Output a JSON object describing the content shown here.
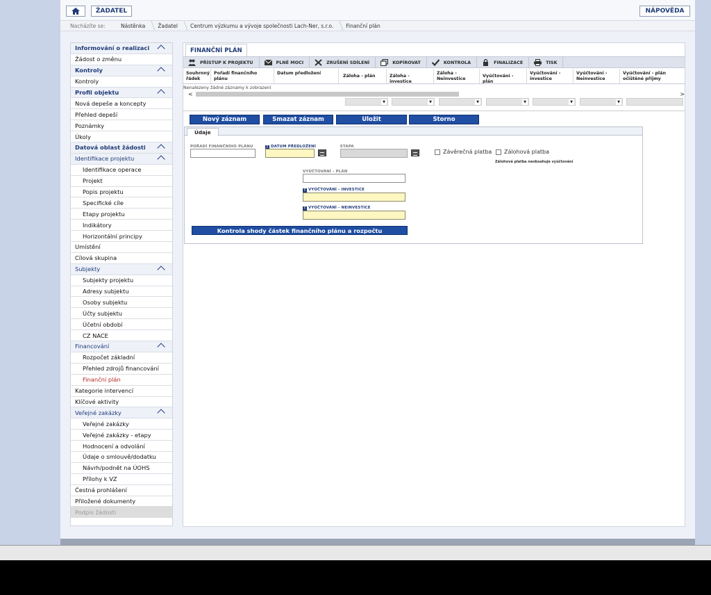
{
  "topbar": {
    "zadatel_label": "ŽADATEL",
    "napoveda_label": "NÁPOVĚDA"
  },
  "breadcrumb": {
    "label": "Nacházíte se:",
    "items": [
      "Nástěnka",
      "Žadatel",
      "Centrum výzkumu a vývoje společnosti Lach-Ner, s.r.o.",
      "Finanční plán"
    ]
  },
  "sidebar": {
    "items": [
      {
        "label": "Informování o realizaci",
        "kind": "header",
        "collapsible": true
      },
      {
        "label": "Žádost o změnu",
        "kind": "item"
      },
      {
        "label": "Kontroly",
        "kind": "header",
        "collapsible": true
      },
      {
        "label": "Kontroly",
        "kind": "item"
      },
      {
        "label": "Profil objektu",
        "kind": "header",
        "collapsible": true
      },
      {
        "label": "Nová depeše a koncepty",
        "kind": "item"
      },
      {
        "label": "Přehled depeší",
        "kind": "item"
      },
      {
        "label": "Poznámky",
        "kind": "item"
      },
      {
        "label": "Úkoly",
        "kind": "item"
      },
      {
        "label": "Datová oblast žádosti",
        "kind": "header",
        "collapsible": true
      },
      {
        "label": "Identifikace projektu",
        "kind": "sect",
        "collapsible": true
      },
      {
        "label": "Identifikace operace",
        "kind": "sub"
      },
      {
        "label": "Projekt",
        "kind": "sub"
      },
      {
        "label": "Popis projektu",
        "kind": "sub"
      },
      {
        "label": "Specifické cíle",
        "kind": "sub"
      },
      {
        "label": "Etapy projektu",
        "kind": "sub"
      },
      {
        "label": "Indikátory",
        "kind": "sub"
      },
      {
        "label": "Horizontální principy",
        "kind": "sub"
      },
      {
        "label": "Umístění",
        "kind": "item"
      },
      {
        "label": "Cílová skupina",
        "kind": "item"
      },
      {
        "label": "Subjekty",
        "kind": "sect",
        "collapsible": true
      },
      {
        "label": "Subjekty projektu",
        "kind": "sub"
      },
      {
        "label": "Adresy subjektu",
        "kind": "sub"
      },
      {
        "label": "Osoby subjektu",
        "kind": "sub"
      },
      {
        "label": "Účty subjektu",
        "kind": "sub"
      },
      {
        "label": "Účetní období",
        "kind": "sub"
      },
      {
        "label": "CZ NACE",
        "kind": "sub"
      },
      {
        "label": "Financování",
        "kind": "sect",
        "collapsible": true
      },
      {
        "label": "Rozpočet základní",
        "kind": "sub"
      },
      {
        "label": "Přehled zdrojů financování",
        "kind": "sub"
      },
      {
        "label": "Finanční plán",
        "kind": "sub",
        "active": true
      },
      {
        "label": "Kategorie intervencí",
        "kind": "item"
      },
      {
        "label": "Klíčové aktivity",
        "kind": "item"
      },
      {
        "label": "Veřejné zakázky",
        "kind": "sect",
        "collapsible": true
      },
      {
        "label": "Veřejné zakázky",
        "kind": "sub"
      },
      {
        "label": "Veřejné zakázky - etapy",
        "kind": "sub"
      },
      {
        "label": "Hodnocení a odvolání",
        "kind": "sub"
      },
      {
        "label": "Údaje o smlouvě/dodatku",
        "kind": "sub"
      },
      {
        "label": "Návrh/podnět na ÚOHS",
        "kind": "sub"
      },
      {
        "label": "Přílohy k VZ",
        "kind": "sub"
      },
      {
        "label": "Čestná prohlášení",
        "kind": "item"
      },
      {
        "label": "Přiložené dokumenty",
        "kind": "item"
      },
      {
        "label": "Podpis žádosti",
        "kind": "disabled"
      }
    ]
  },
  "main": {
    "tab_title": "FINANČNÍ PLÁN",
    "toolbar": [
      {
        "label": "PŘÍSTUP K PROJEKTU",
        "icon": "people-icon"
      },
      {
        "label": "PLNÉ MOCI",
        "icon": "envelope-icon"
      },
      {
        "label": "ZRUŠENÍ SDÍLENÍ",
        "icon": "close-icon"
      },
      {
        "label": "KOPÍROVAT",
        "icon": "copy-icon"
      },
      {
        "label": "KONTROLA",
        "icon": "check-icon"
      },
      {
        "label": "FINALIZACE",
        "icon": "lock-icon"
      },
      {
        "label": "TISK",
        "icon": "printer-icon"
      }
    ],
    "grid": {
      "columns": [
        "Souhrnný řádek",
        "Pořadí finančního plánu",
        "Datum předložení",
        "Záloha - plán",
        "Záloha - investice",
        "Záloha - Neinvestice",
        "Vyúčtování - plán",
        "Vyúčtování - investice",
        "Vyúčtování - Neinvestice",
        "Vyúčtování - plán očištěné příjmy"
      ],
      "empty_text": "Nenalezeny žádné záznamy k zobrazení",
      "scroll_left": "<",
      "scroll_right": ">",
      "scroll_thumb_fraction": 0.55
    },
    "actions": {
      "new_record": "Nový záznam",
      "delete_record": "Smazat záznam",
      "save": "Uložit",
      "cancel": "Storno"
    },
    "form": {
      "tab_label": "Údaje",
      "poradi_label": "POŘADÍ FINANČNÍHO PLÁNU",
      "datum_label": "DATUM PŘEDLOŽENÍ",
      "etapa_label": "ETAPA",
      "zaverecna_label": "Závěrečná platba",
      "zalohova_label": "Zálohová platba",
      "zalohova_note": "Zálohová platba neobsahuje vyúčtování",
      "vyuct_plan_label": "VYÚČTOVÁNÍ - PLÁN",
      "vyuct_inv_label": "VYÚČTOVÁNÍ - INVESTICE",
      "vyuct_neinv_label": "VYÚČTOVÁNÍ - NEINVESTICE",
      "check_button": "Kontrola shody částek finančního plánu a rozpočtu",
      "required_mark": "!"
    }
  }
}
